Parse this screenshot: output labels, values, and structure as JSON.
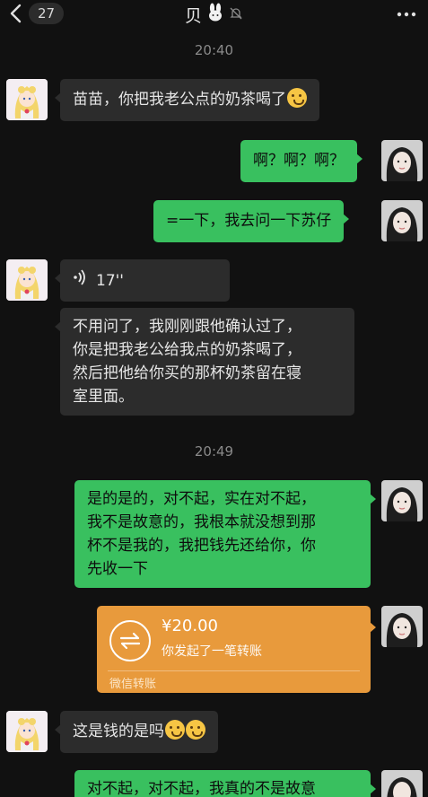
{
  "header": {
    "badge": "27",
    "title": "贝"
  },
  "timestamps": [
    "20:40",
    "20:49"
  ],
  "messages": [
    {
      "text": "苗苗，你把我老公点的奶茶喝了"
    },
    {
      "text": "啊？啊？啊？"
    },
    {
      "text": "=一下，我去问一下苏仔"
    },
    {
      "duration": "17''"
    },
    {
      "lines": [
        "不用问了，我刚刚跟他确认过了，",
        "你是把我老公给我点的奶茶喝了，",
        "然后把他给你买的那杯奶茶留在寝",
        "室里面。"
      ]
    },
    {
      "lines": [
        "是的是的，对不起，实在对不起，",
        "我不是故意的，我根本就没想到那",
        "杯不是我的，我把钱先还给你，你",
        "先收一下"
      ]
    },
    {
      "amount": "¥20.00",
      "desc": "你发起了一笔转账",
      "footer": "微信转账"
    },
    {
      "text": "这是钱的是吗"
    },
    {
      "text": "对不起，对不起，我真的不是故意"
    }
  ],
  "colors": {
    "background": "#111111",
    "incoming_bubble": "#2c2c2c",
    "outgoing_bubble": "#39c05f",
    "transfer": "#e89a3c"
  }
}
